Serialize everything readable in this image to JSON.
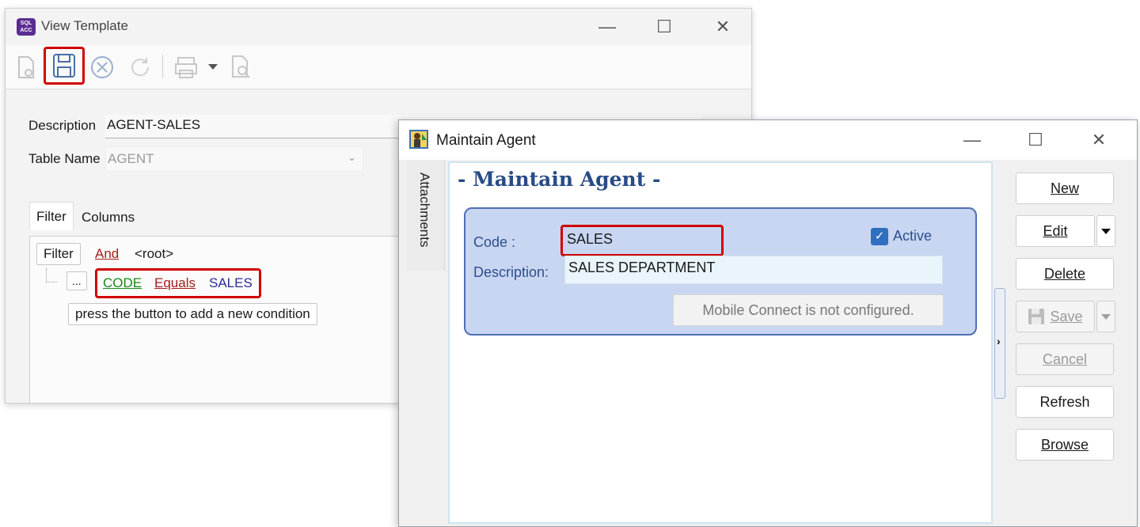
{
  "view_template": {
    "title": "View Template",
    "logo_text": "SQL ACC",
    "window_controls": [
      "—",
      "☐",
      "✕"
    ],
    "description_label": "Description",
    "description_value": "AGENT-SALES",
    "table_name_label": "Table Name",
    "table_name_value": "AGENT",
    "tabs": [
      "Filter",
      "Columns"
    ],
    "filter": {
      "button_label": "Filter",
      "operator": "And",
      "root": "<root>",
      "ellipsis": "...",
      "condition_field": "CODE",
      "condition_op": "Equals",
      "condition_value": "SALES",
      "hint": "press the button to add a new condition"
    },
    "colors": {
      "field_green": "#1a8a1a",
      "op_red": "#a81b1b",
      "value_blue": "#2a2a9a",
      "highlight_red": "#d10000"
    }
  },
  "maintain_agent": {
    "title": "Maintain Agent",
    "window_controls": [
      "—",
      "☐",
      "✕"
    ],
    "side_tab": "Attachments",
    "heading": "- Maintain Agent -",
    "code_label": "Code :",
    "code_value": "SALES",
    "active_label": "Active",
    "active_checked": true,
    "description_label": "Description:",
    "description_value": "SALES DEPARTMENT",
    "mobile_status": "Mobile Connect is not configured.",
    "buttons": {
      "new": "New",
      "edit": "Edit",
      "delete": "Delete",
      "save": "Save",
      "cancel": "Cancel",
      "refresh": "Refresh",
      "browse": "Browse"
    },
    "colors": {
      "heading": "#274b86",
      "group_bg": "#c8d6f1",
      "group_border": "#4f6fb4"
    }
  }
}
